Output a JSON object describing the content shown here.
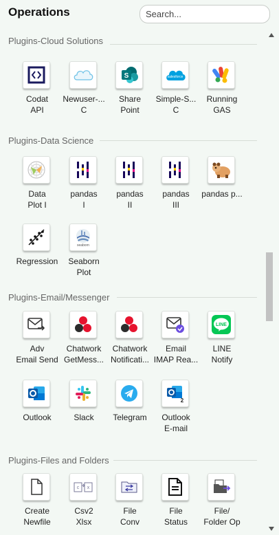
{
  "header": {
    "title": "Operations",
    "search_placeholder": "Search..."
  },
  "sections": {
    "cloud": {
      "title": "Plugins-Cloud Solutions",
      "items": [
        {
          "label": "Codat\nAPI",
          "icon": "codat-icon"
        },
        {
          "label": "Newuser-...\nC",
          "icon": "salesforce-cloud-icon"
        },
        {
          "label": "Share\nPoint",
          "icon": "sharepoint-icon"
        },
        {
          "label": "Simple-S...\nC",
          "icon": "salesforce-icon"
        },
        {
          "label": "Running\nGAS",
          "icon": "apps-script-icon"
        }
      ]
    },
    "datasci": {
      "title": "Plugins-Data Science",
      "items": [
        {
          "label": "Data\nPlot I",
          "icon": "polar-plot-icon"
        },
        {
          "label": "pandas\nI",
          "icon": "pandas-icon"
        },
        {
          "label": "pandas\nII",
          "icon": "pandas-icon"
        },
        {
          "label": "pandas\nIII",
          "icon": "pandas-icon"
        },
        {
          "label": "pandas p...",
          "icon": "panda-animal-icon"
        },
        {
          "label": "Regression",
          "icon": "regression-icon"
        },
        {
          "label": "Seaborn\nPlot",
          "icon": "seaborn-icon"
        }
      ]
    },
    "email": {
      "title": "Plugins-Email/Messenger",
      "items": [
        {
          "label": "Adv\nEmail Send",
          "icon": "email-send-icon"
        },
        {
          "label": "Chatwork\nGetMess...",
          "icon": "chatwork-icon"
        },
        {
          "label": "Chatwork\nNotificati...",
          "icon": "chatwork-icon"
        },
        {
          "label": "Email\nIMAP Rea...",
          "icon": "email-imap-icon"
        },
        {
          "label": "LINE\nNotify",
          "icon": "line-icon"
        },
        {
          "label": "Outlook",
          "icon": "outlook-icon"
        },
        {
          "label": "Slack",
          "icon": "slack-icon"
        },
        {
          "label": "Telegram",
          "icon": "telegram-icon"
        },
        {
          "label": "Outlook\nE-mail",
          "icon": "outlook-email-icon"
        }
      ]
    },
    "files": {
      "title": "Plugins-Files and Folders",
      "items": [
        {
          "label": "Create\nNewfile",
          "icon": "new-file-icon"
        },
        {
          "label": "Csv2\nXlsx",
          "icon": "csv-convert-icon"
        },
        {
          "label": "File\nConv",
          "icon": "file-convert-icon"
        },
        {
          "label": "File\nStatus",
          "icon": "file-status-icon"
        },
        {
          "label": "File/\nFolder Op",
          "icon": "folder-op-icon"
        }
      ]
    }
  },
  "colors": {
    "background": "#f3f8f4",
    "accent": "#1a1a5e",
    "slack": "#e01e5a",
    "line": "#06c755",
    "outlook": "#0078d4",
    "telegram": "#2aabee"
  }
}
